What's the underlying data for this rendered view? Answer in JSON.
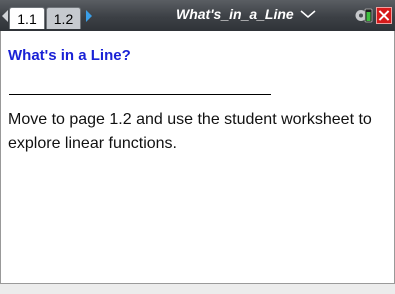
{
  "tabs": [
    {
      "label": "1.1",
      "active": true
    },
    {
      "label": "1.2",
      "active": false
    }
  ],
  "document_title": "What's_in_a_Line",
  "colors": {
    "toolbar": "#3c4045",
    "heading": "#1a22d6",
    "next_arrow": "#3a9fe8",
    "close": "#d61b1b",
    "battery": "#3fbf3f"
  },
  "icons": {
    "prev": "triangle-left",
    "next": "triangle-right",
    "title_menu": "chevron-down",
    "settings": "gear-battery",
    "close": "x"
  },
  "content": {
    "heading": "What's in a Line?",
    "body": "Move to page 1.2 and use the student worksheet to explore linear functions."
  }
}
